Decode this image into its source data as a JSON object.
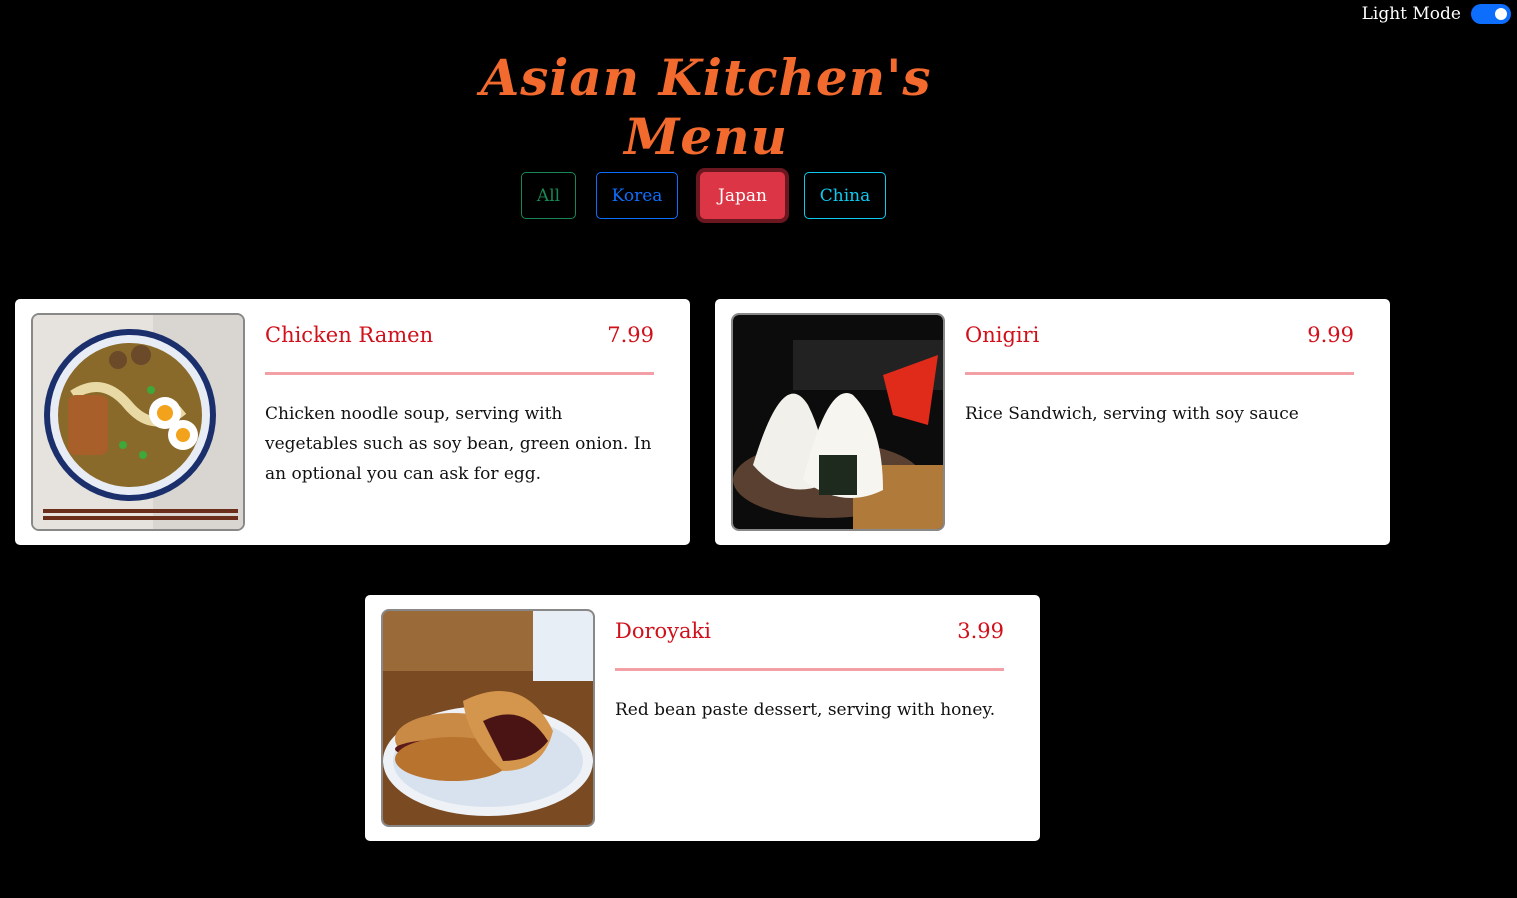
{
  "theme": {
    "accent_title": "#f26a2e",
    "accent_red": "#d0101a",
    "divider_pink": "#f2a0a6",
    "switch_blue": "#0d6efd"
  },
  "mode_toggle": {
    "label": "Light Mode"
  },
  "page": {
    "title": "Asian Kitchen's Menu"
  },
  "filters": [
    {
      "label": "All",
      "color": "#198754",
      "active": false
    },
    {
      "label": "Korea",
      "color": "#0d6efd",
      "active": false
    },
    {
      "label": "Japan",
      "color": "#dc3545",
      "active": true
    },
    {
      "label": "China",
      "color": "#0dcaf0",
      "active": false
    }
  ],
  "menu_items": [
    {
      "name": "Chicken Ramen",
      "price": "7.99",
      "description": "Chicken noodle soup, serving with vegetables such as soy bean, green onion. In an optional you can ask for egg.",
      "image": "ramen-bowl"
    },
    {
      "name": "Onigiri",
      "price": "9.99",
      "description": "Rice Sandwich, serving with soy sauce",
      "image": "rice-balls"
    },
    {
      "name": "Doroyaki",
      "price": "3.99",
      "description": "Red bean paste dessert, serving with honey.",
      "image": "pancake-dessert"
    }
  ]
}
